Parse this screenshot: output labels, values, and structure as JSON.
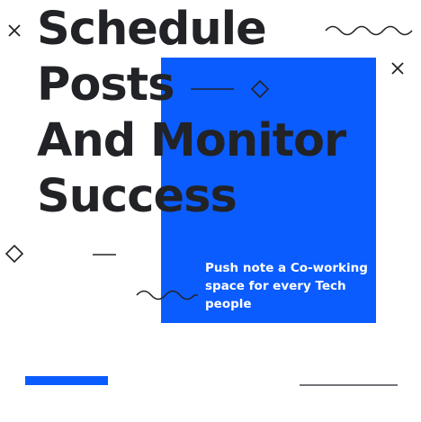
{
  "headline": {
    "lines": [
      "Schedule",
      "Posts",
      "And Monitor",
      "Success"
    ]
  },
  "note": {
    "text": "Push note a Co-working space for every Tech people"
  },
  "colors": {
    "accent": "#0b5cff",
    "text_dark": "#222327",
    "text_light": "#ffffff",
    "decoration": "#222327"
  },
  "decorations": {
    "icons": [
      "close-icon",
      "close-icon",
      "diamond-icon",
      "diamond-icon",
      "wavy-line-icon",
      "wavy-line-icon"
    ]
  }
}
